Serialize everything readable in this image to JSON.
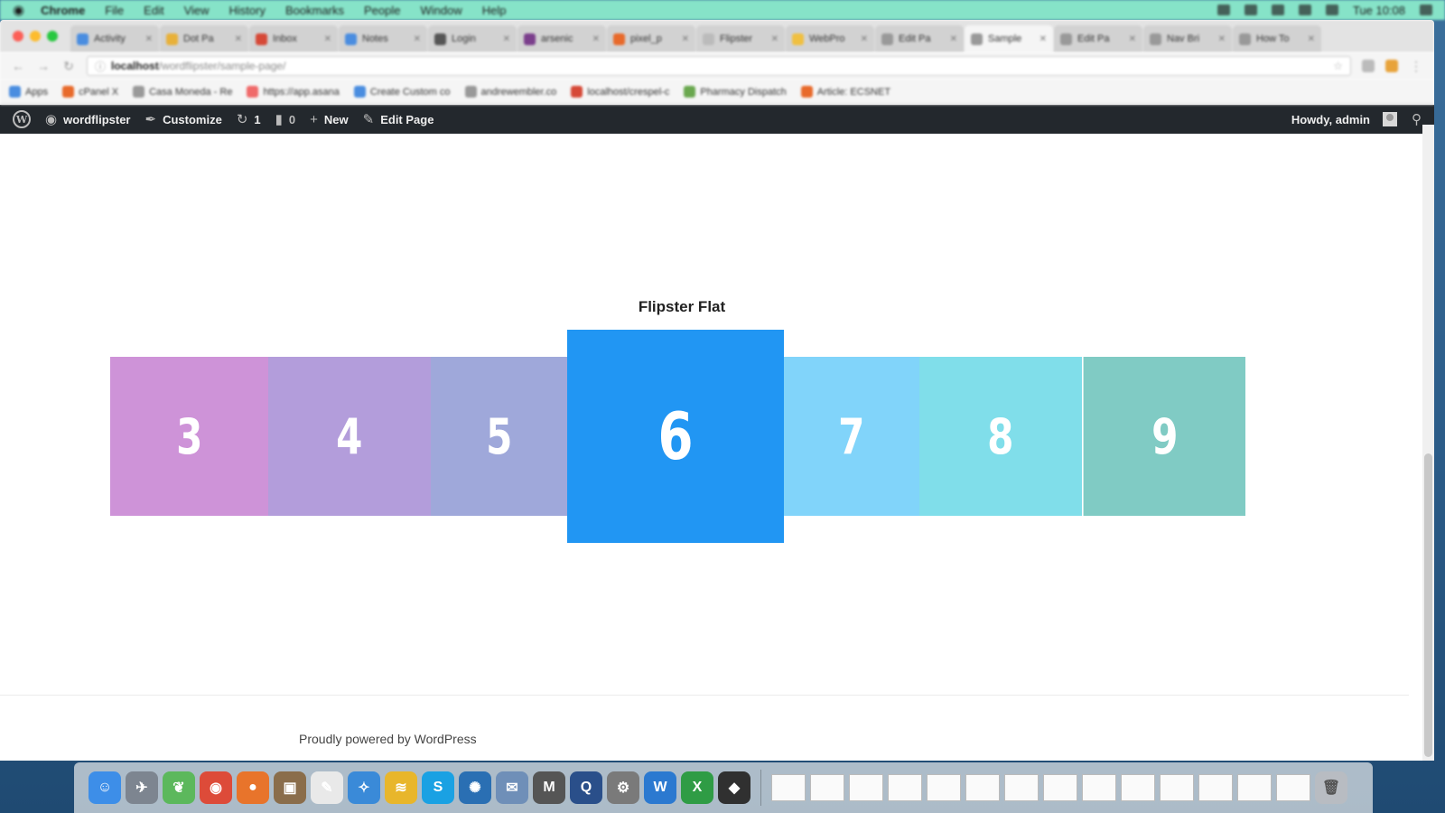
{
  "os_menubar": {
    "app_name": "Chrome",
    "menus": [
      "File",
      "Edit",
      "View",
      "History",
      "Bookmarks",
      "People",
      "Window",
      "Help"
    ],
    "clock": "Tue 10:08"
  },
  "browser": {
    "tabs": [
      {
        "label": "Activity",
        "color": "#4a8de0"
      },
      {
        "label": "Dot Pa",
        "color": "#e8b13a"
      },
      {
        "label": "Inbox",
        "color": "#d64937"
      },
      {
        "label": "Notes",
        "color": "#4a8de0"
      },
      {
        "label": "Login",
        "color": "#555555"
      },
      {
        "label": "arsenic",
        "color": "#7b3f8c"
      },
      {
        "label": "pixel_p",
        "color": "#e86a2b"
      },
      {
        "label": "Flipster",
        "color": "#bbbbbb"
      },
      {
        "label": "WebPro",
        "color": "#f0c040"
      },
      {
        "label": "Edit Pa",
        "color": "#999999"
      },
      {
        "label": "Sample",
        "color": "#999999",
        "active": true
      },
      {
        "label": "Edit Pa",
        "color": "#999999"
      },
      {
        "label": "Nav Bri",
        "color": "#999999"
      },
      {
        "label": "How To",
        "color": "#999999"
      }
    ],
    "url_host": "localhost",
    "url_path": "/wordflipster/sample-page/",
    "bookmarks": [
      {
        "label": "Apps",
        "color": "#4a8de0"
      },
      {
        "label": "cPanel X",
        "color": "#e86a2b"
      },
      {
        "label": "Casa Moneda - Re",
        "color": "#999999"
      },
      {
        "label": "https://app.asana",
        "color": "#f06a6a"
      },
      {
        "label": "Create Custom co",
        "color": "#4a8de0"
      },
      {
        "label": "andrewembler.co",
        "color": "#999999"
      },
      {
        "label": "localhost/crespel-c",
        "color": "#d64937"
      },
      {
        "label": "Pharmacy Dispatch",
        "color": "#6aa84f"
      },
      {
        "label": "Article: ECSNET",
        "color": "#e86a2b"
      }
    ]
  },
  "adminbar": {
    "wp_logo": "W",
    "site_name": "wordflipster",
    "customize": "Customize",
    "updates": "1",
    "comments": "0",
    "new": "New",
    "edit_page": "Edit Page",
    "howdy": "Howdy, admin"
  },
  "page": {
    "title": "Flipster Flat",
    "footer": "Proudly powered by WordPress"
  },
  "flipster": {
    "active_index": 3,
    "items": [
      {
        "label": "3",
        "color": "#ce93d8"
      },
      {
        "label": "4",
        "color": "#b39ddb"
      },
      {
        "label": "5",
        "color": "#9fa8da"
      },
      {
        "label": "6",
        "color": "#2196f3"
      },
      {
        "label": "7",
        "color": "#81d4fa"
      },
      {
        "label": "8",
        "color": "#80deea"
      },
      {
        "label": "9",
        "color": "#80cbc4"
      }
    ]
  },
  "dock": {
    "apps": [
      {
        "name": "finder",
        "color": "#3d8ee8",
        "glyph": "☺"
      },
      {
        "name": "launchpad",
        "color": "#7d8590",
        "glyph": "✈"
      },
      {
        "name": "leaf-app",
        "color": "#5cb85c",
        "glyph": "❦"
      },
      {
        "name": "chrome",
        "color": "#dd4b39",
        "glyph": "◉"
      },
      {
        "name": "firefox",
        "color": "#e8742b",
        "glyph": "●"
      },
      {
        "name": "preview",
        "color": "#8a6d4b",
        "glyph": "▣"
      },
      {
        "name": "textedit",
        "color": "#e9e9e9",
        "glyph": "✎"
      },
      {
        "name": "safari",
        "color": "#3a8ad8",
        "glyph": "✧"
      },
      {
        "name": "wifi-app",
        "color": "#e8b62b",
        "glyph": "≋"
      },
      {
        "name": "skype",
        "color": "#1aa1e3",
        "glyph": "S"
      },
      {
        "name": "sourcetree",
        "color": "#2a6fb3",
        "glyph": "✺"
      },
      {
        "name": "mail-app",
        "color": "#6f8fb8",
        "glyph": "✉"
      },
      {
        "name": "mamp",
        "color": "#555555",
        "glyph": "M"
      },
      {
        "name": "quicktime",
        "color": "#2a4f8a",
        "glyph": "Q"
      },
      {
        "name": "system-preferences",
        "color": "#7a7a7a",
        "glyph": "⚙"
      },
      {
        "name": "word",
        "color": "#2b79d0",
        "glyph": "W"
      },
      {
        "name": "excel",
        "color": "#2f9c45",
        "glyph": "X"
      },
      {
        "name": "sequel-pro",
        "color": "#303030",
        "glyph": "◆"
      }
    ],
    "window_count": 14,
    "trash": "trash"
  }
}
